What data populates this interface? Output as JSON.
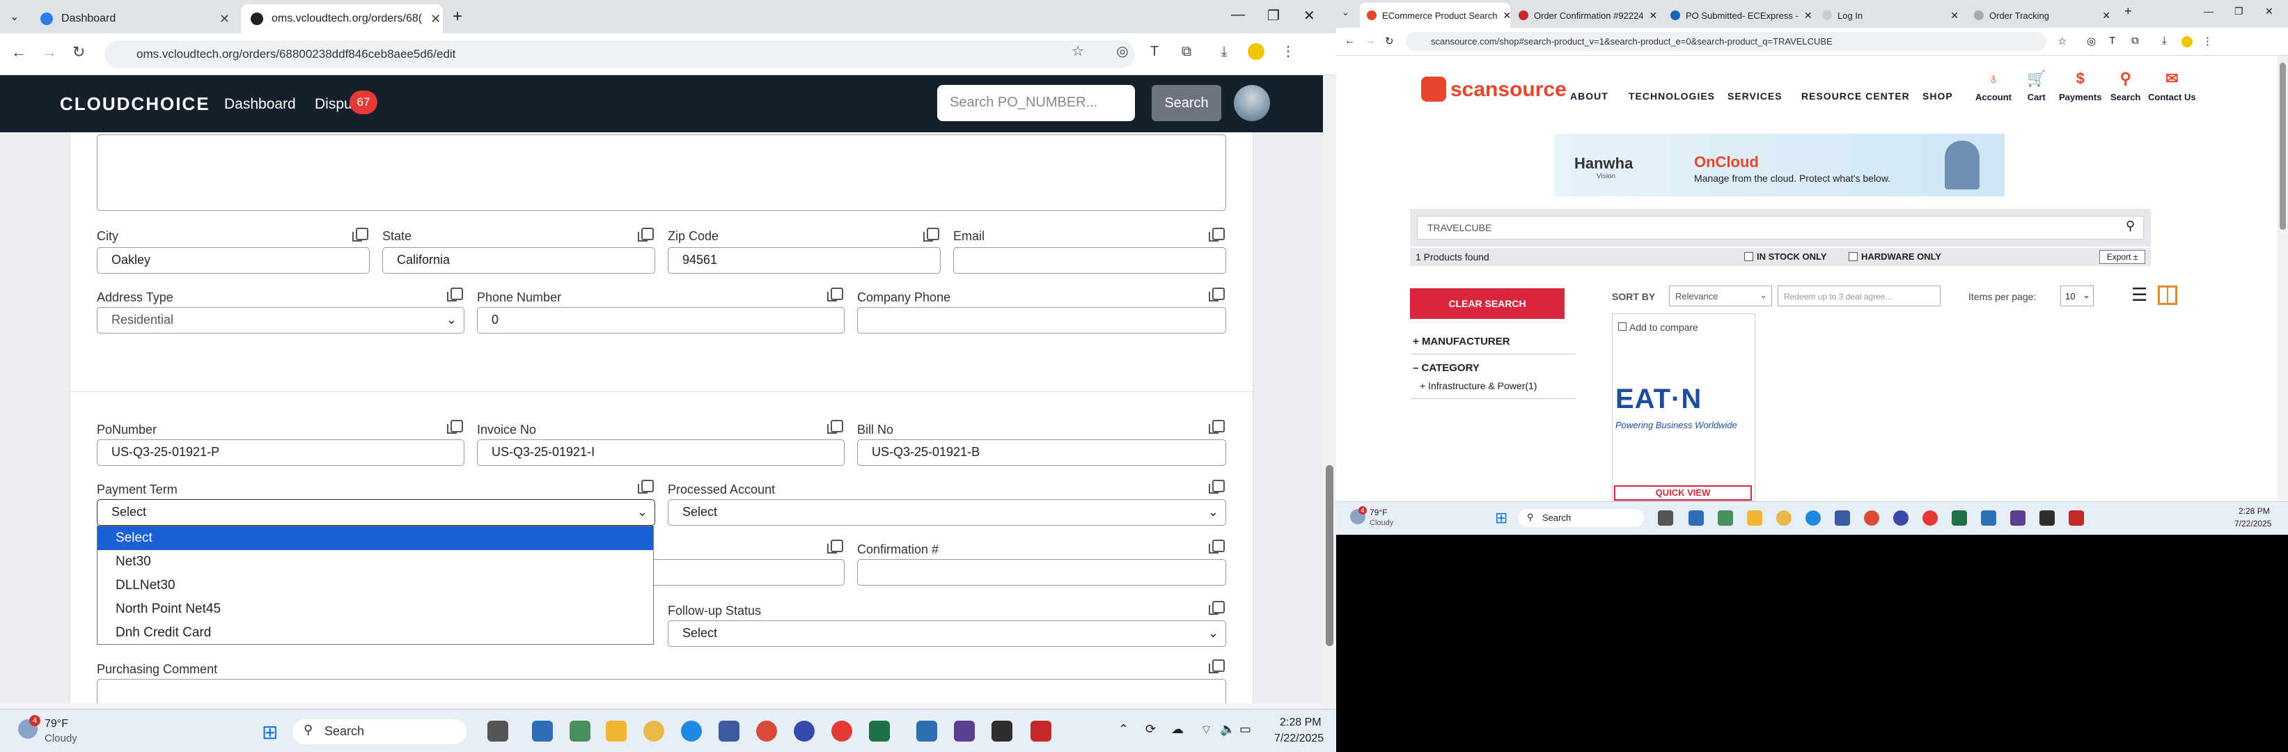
{
  "left": {
    "tabs": [
      {
        "label": "Dashboard"
      },
      {
        "label": "oms.vcloudtech.org/orders/68(",
        "active": true
      }
    ],
    "url": "oms.vcloudtech.org/orders/68800238ddf846ceb8aee5d6/edit",
    "app": {
      "logo": "CLOUDCHOICE",
      "nav": [
        "Dashboard",
        "Dispu"
      ],
      "badge": "67",
      "search_placeholder": "Search PO_NUMBER...",
      "search_button": "Search"
    },
    "address": {
      "city_label": "City",
      "city": "Oakley",
      "state_label": "State",
      "state": "California",
      "zip_label": "Zip Code",
      "zip": "94561",
      "email_label": "Email",
      "email": "",
      "address_type_label": "Address Type",
      "address_type": "Residential",
      "phone_label": "Phone Number",
      "phone": "0",
      "company_phone_label": "Company Phone",
      "company_phone": ""
    },
    "order": {
      "po_label": "PoNumber",
      "po": "US-Q3-25-01921-P",
      "invoice_label": "Invoice No",
      "invoice": "US-Q3-25-01921-I",
      "bill_label": "Bill No",
      "bill": "US-Q3-25-01921-B",
      "payment_term_label": "Payment Term",
      "payment_term": "Select",
      "processed_account_label": "Processed Account",
      "processed_account": "Select",
      "confirmation_label": "Confirmation #",
      "confirmation": "",
      "followup_label": "Follow-up Status",
      "followup": "Select",
      "purchasing_comment_label": "Purchasing Comment"
    },
    "payment_options": [
      "Select",
      "Net30",
      "DLLNet30",
      "North Point Net45",
      "Dnh Credit Card"
    ],
    "taskbar": {
      "temp": "79°F",
      "weather": "Cloudy",
      "weather_badge": "4",
      "search": "Search",
      "time": "2:28 PM",
      "date": "7/22/2025"
    }
  },
  "right": {
    "tabs": [
      "ECommerce Product Search",
      "Order Confirmation #92224",
      "PO Submitted- ECExpress -",
      "Log In",
      "Order Tracking"
    ],
    "url": "scansource.com/shop#search-product_v=1&search-product_e=0&search-product_q=TRAVELCUBE",
    "brand": "scansource",
    "nav": [
      "ABOUT",
      "TECHNOLOGIES",
      "SERVICES",
      "RESOURCE CENTER",
      "SHOP"
    ],
    "icons": [
      {
        "glyph": "♁",
        "label": "Account"
      },
      {
        "glyph": "🛒",
        "label": "Cart"
      },
      {
        "glyph": "$",
        "label": "Payments"
      },
      {
        "glyph": "⚲",
        "label": "Search"
      },
      {
        "glyph": "✉",
        "label": "Contact Us"
      }
    ],
    "ad": {
      "brand": "Hanwha",
      "brand_sub": "Vision",
      "product": "OnCloud",
      "tagline": "Manage from the cloud. Protect what's below."
    },
    "search_value": "TRAVELCUBE",
    "found": "1 Products found",
    "in_stock": "IN STOCK ONLY",
    "hardware": "HARDWARE ONLY",
    "export": "Export ±",
    "clear": "CLEAR SEARCH",
    "sort_label": "SORT BY",
    "sort_value": "Relevance",
    "deal_placeholder": "Redeem up to 3 deal agree...",
    "items_label": "Items per page:",
    "items_value": "10",
    "manufacturer": "MANUFACTURER",
    "category": "CATEGORY",
    "category_item": "Infrastructure & Power(1)",
    "compare": "Add to compare",
    "product_logo": "EAT·N",
    "product_logo_sub": "Powering Business Worldwide",
    "quick_view": "QUICK VIEW",
    "taskbar": {
      "temp": "79°F",
      "weather": "Cloudy",
      "weather_badge": "4",
      "search": "Search",
      "time": "2:28 PM",
      "date": "7/22/2025"
    }
  }
}
